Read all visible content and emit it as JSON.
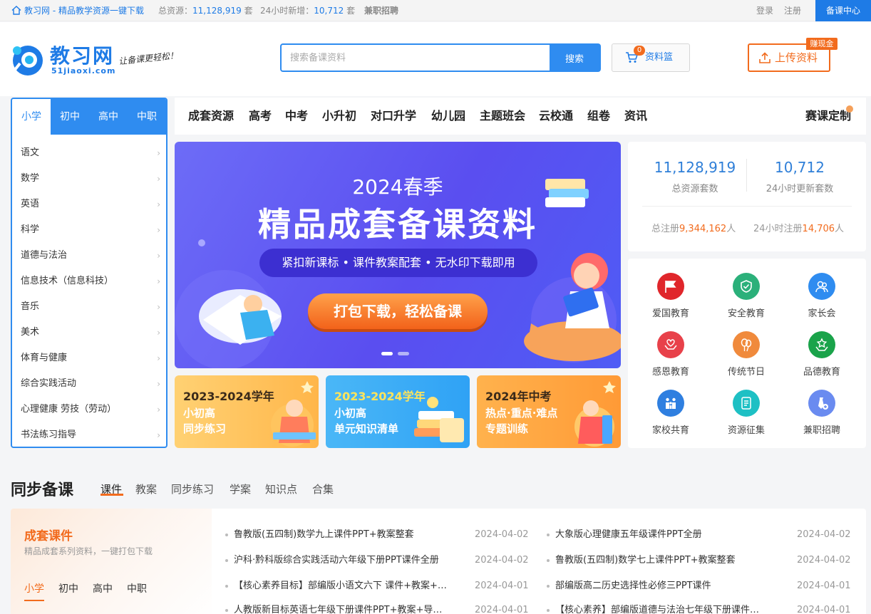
{
  "topbar": {
    "site_link": "教习网 - 精品教学资源一键下载",
    "total_label": "总资源：",
    "total_value": "11,128,919",
    "total_unit": "套",
    "new_label": "24小时新增：",
    "new_value": "10,712",
    "new_unit": "套",
    "parttime": "兼职招聘",
    "login": "登录",
    "register": "注册",
    "course_center": "备课中心"
  },
  "logo": {
    "brand": "教习网",
    "domain": "51jiaoxi.com",
    "slogan": "让备课更轻松！"
  },
  "search": {
    "placeholder": "搜索备课资料",
    "button": "搜索"
  },
  "basket": {
    "label": "资料篮",
    "count": "0"
  },
  "upload": {
    "label": "上传资料",
    "badge": "赚现金"
  },
  "stage_tabs": [
    "小学",
    "初中",
    "高中",
    "中职"
  ],
  "subjects": [
    "语文",
    "数学",
    "英语",
    "科学",
    "道德与法治",
    "信息技术（信息科技）",
    "音乐",
    "美术",
    "体育与健康",
    "综合实践活动",
    "心理健康 劳技（劳动）",
    "书法练习指导"
  ],
  "nav": {
    "items": [
      "成套资源",
      "高考",
      "中考",
      "小升初",
      "对口升学",
      "幼儿园",
      "主题班会",
      "云校通",
      "组卷",
      "资讯"
    ],
    "custom": "赛课定制"
  },
  "banner": {
    "line1": "2024春季",
    "line2": "精品成套备课资料",
    "line3": "紧扣新课标 • 课件教案配套 • 无水印下载即用",
    "cta": "打包下载，轻松备课"
  },
  "promos": [
    {
      "title": "2023-2024学年",
      "sub": "小初高\n同步练习"
    },
    {
      "title": "2023-2024学年",
      "sub": "小初高\n单元知识清单"
    },
    {
      "title": "2024年中考",
      "sub": "热点·重点·难点\n专题训练"
    }
  ],
  "stats": {
    "total_num": "11,128,919",
    "total_label": "总资源套数",
    "new_num": "10,712",
    "new_label": "24小时更新套数",
    "reg_total_label": "总注册",
    "reg_total_value": "9,344,162",
    "reg_new_label": "24小时注册",
    "reg_new_value": "14,706",
    "person": "人"
  },
  "quick_icons": [
    {
      "label": "爱国教育",
      "icon": "flag-icon",
      "color": "#e0262b"
    },
    {
      "label": "安全教育",
      "icon": "shield-icon",
      "color": "#2bb07a"
    },
    {
      "label": "家长会",
      "icon": "people-icon",
      "color": "#2f8cf0"
    },
    {
      "label": "感恩教育",
      "icon": "heart-hands-icon",
      "color": "#e8414a"
    },
    {
      "label": "传统节日",
      "icon": "balloon-icon",
      "color": "#f08a3c"
    },
    {
      "label": "品德教育",
      "icon": "star-hands-icon",
      "color": "#1aa34a"
    },
    {
      "label": "家校共育",
      "icon": "family-icon",
      "color": "#2f7fe0"
    },
    {
      "label": "资源征集",
      "icon": "document-icon",
      "color": "#1ec0c4"
    },
    {
      "label": "兼职招聘",
      "icon": "tie-icon",
      "color": "#6a8bf0"
    }
  ],
  "sync": {
    "title": "同步备课",
    "tabs": [
      "课件",
      "教案",
      "同步练习",
      "学案",
      "知识点",
      "合集"
    ],
    "card_title": "成套课件",
    "card_sub": "精品成套系列资料，一键打包下载",
    "card_tabs": [
      "小学",
      "初中",
      "高中",
      "中职"
    ],
    "items": [
      {
        "title": "鲁教版(五四制)数学九上课件PPT+教案整套",
        "date": "2024-04-02"
      },
      {
        "title": "大象版心理健康五年级课件PPT全册",
        "date": "2024-04-02"
      },
      {
        "title": "沪科·黔科版综合实践活动六年级下册PPT课件全册",
        "date": "2024-04-02"
      },
      {
        "title": "鲁教版(五四制)数学七上课件PPT+教案整套",
        "date": "2024-04-02"
      },
      {
        "title": "【核心素养目标】部编版小语文六下 课件+教案+…",
        "date": "2024-04-01"
      },
      {
        "title": "部编版高二历史选择性必修三PPT课件",
        "date": "2024-04-01"
      },
      {
        "title": "人教版新目标英语七年级下册课件PPT+教案+导…",
        "date": "2024-04-01"
      },
      {
        "title": "【核心素养】部编版道德与法治七年级下册课件…",
        "date": "2024-04-01"
      }
    ]
  }
}
